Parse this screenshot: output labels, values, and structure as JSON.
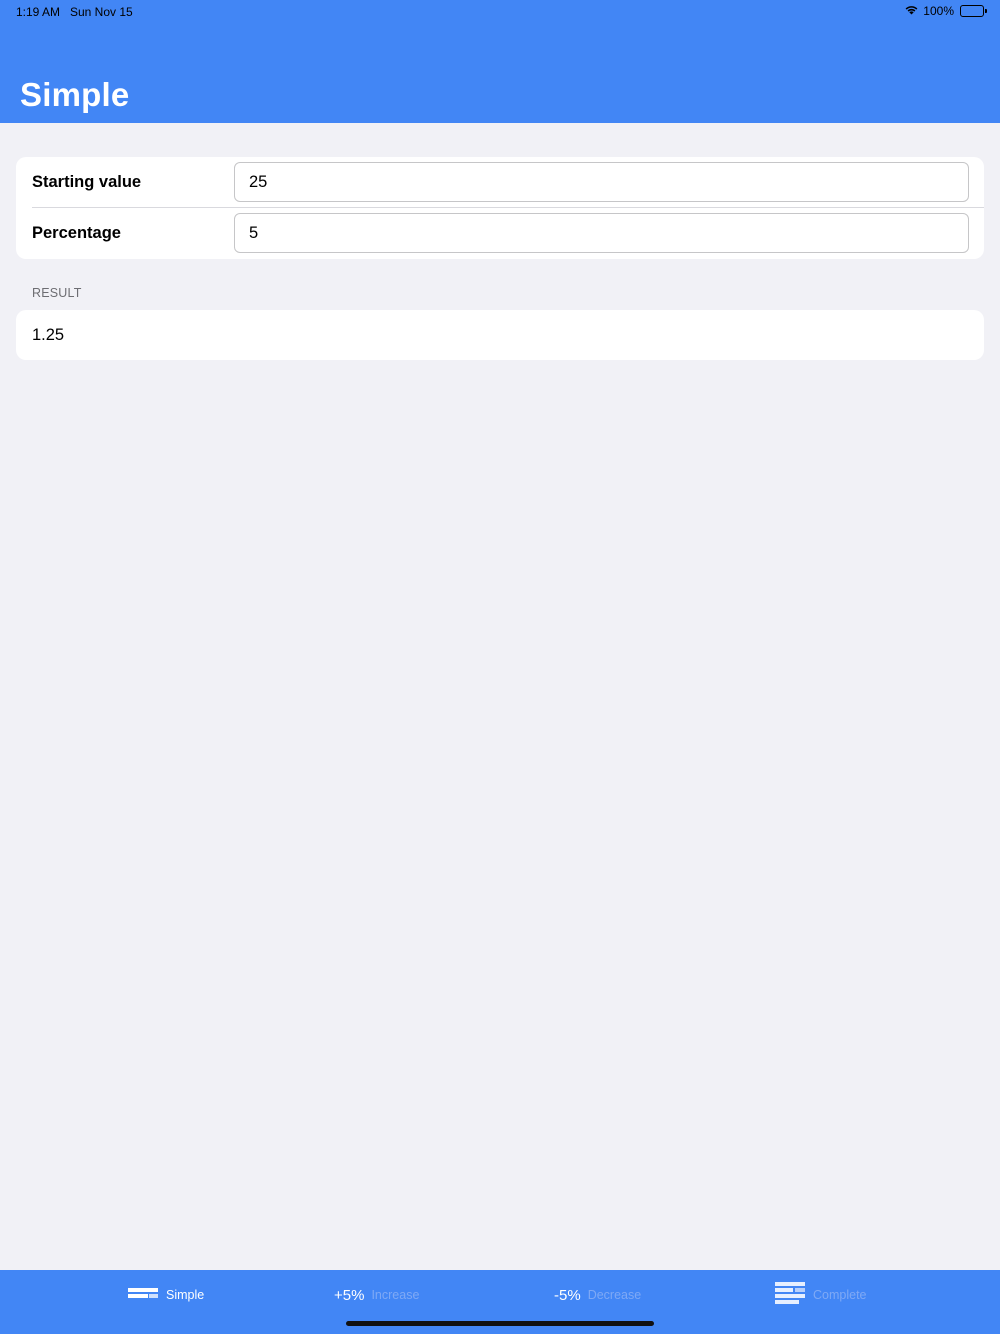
{
  "status_bar": {
    "time": "1:19 AM",
    "date": "Sun Nov 15",
    "battery": "100%"
  },
  "header": {
    "title": "Simple",
    "background_color": "#4286f5"
  },
  "form": {
    "starting_value": {
      "label": "Starting value",
      "value": "25"
    },
    "percentage": {
      "label": "Percentage",
      "value": "5"
    }
  },
  "result": {
    "section_label": "RESULT",
    "value": "1.25"
  },
  "tabbar": {
    "tabs": [
      {
        "label": "Simple",
        "icon": "bar-lines-icon",
        "active": true
      },
      {
        "label": "Increase",
        "icon_text": "+5%",
        "active": false
      },
      {
        "label": "Decrease",
        "icon_text": "-5%",
        "active": false
      },
      {
        "label": "Complete",
        "icon": "stacked-bars-icon",
        "active": false
      }
    ]
  }
}
